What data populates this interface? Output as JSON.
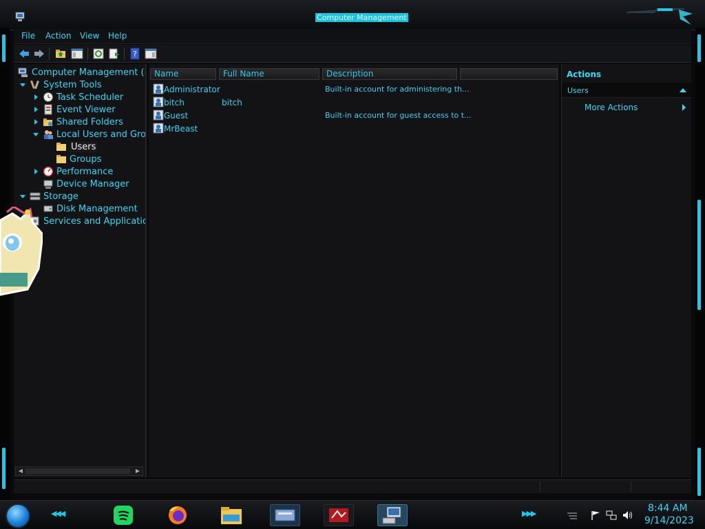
{
  "window": {
    "title": "Computer Management"
  },
  "menu": [
    {
      "label": "File"
    },
    {
      "label": "Action"
    },
    {
      "label": "View"
    },
    {
      "label": "Help"
    }
  ],
  "toolbar": {
    "buttons": [
      {
        "icon": "back-arrow-icon"
      },
      {
        "icon": "forward-arrow-icon"
      },
      {
        "icon": "up-folder-icon"
      },
      {
        "icon": "show-hide-console-tree-icon"
      },
      {
        "icon": "refresh-icon"
      },
      {
        "icon": "export-list-icon"
      },
      {
        "icon": "help-icon"
      },
      {
        "icon": "show-action-pane-icon"
      }
    ]
  },
  "tree": {
    "items": [
      {
        "label": "Computer Management (Loc",
        "icon": "computer-management-icon",
        "level": 0
      },
      {
        "label": "System Tools",
        "icon": "tools-icon",
        "level": 1,
        "expanded": true
      },
      {
        "label": "Task Scheduler",
        "icon": "clock-icon",
        "level": 2
      },
      {
        "label": "Event Viewer",
        "icon": "event-viewer-icon",
        "level": 2
      },
      {
        "label": "Shared Folders",
        "icon": "shared-folder-icon",
        "level": 2
      },
      {
        "label": "Local Users and Grou",
        "icon": "users-icon",
        "level": 2,
        "expanded": true
      },
      {
        "label": "Users",
        "icon": "folder-icon",
        "level": 3,
        "selected": true
      },
      {
        "label": "Groups",
        "icon": "folder-icon",
        "level": 3
      },
      {
        "label": "Performance",
        "icon": "performance-icon",
        "level": 2
      },
      {
        "label": "Device Manager",
        "icon": "device-manager-icon",
        "level": 2
      },
      {
        "label": "Storage",
        "icon": "storage-icon",
        "level": 1,
        "expanded": true
      },
      {
        "label": "Disk Management",
        "icon": "disk-management-icon",
        "level": 2
      },
      {
        "label": "Services and Applications",
        "icon": "services-icon",
        "level": 1
      }
    ]
  },
  "list": {
    "columns": [
      "Name",
      "Full Name",
      "Description",
      ""
    ],
    "rows": [
      {
        "name": "Administrator",
        "full_name": "",
        "description": "Built-in account for administering th..."
      },
      {
        "name": "bitch",
        "full_name": "bitch",
        "description": ""
      },
      {
        "name": "Guest",
        "full_name": "",
        "description": "Built-in account for guest access to t..."
      },
      {
        "name": "MrBeast",
        "full_name": "",
        "description": ""
      }
    ]
  },
  "actions": {
    "title": "Actions",
    "section": "Users",
    "items": [
      {
        "label": "More Actions"
      }
    ]
  },
  "taskbar": {
    "apps": [
      {
        "icon": "spotify-icon"
      },
      {
        "icon": "firefox-icon"
      },
      {
        "icon": "file-explorer-icon"
      },
      {
        "icon": "control-panel-icon"
      },
      {
        "icon": "media-app-icon"
      },
      {
        "icon": "computer-management-icon",
        "active": true
      }
    ],
    "tray": [
      {
        "icon": "flag-icon"
      },
      {
        "icon": "network-icon"
      },
      {
        "icon": "volume-icon"
      }
    ],
    "time": "8:44 AM",
    "date": "9/14/2023"
  },
  "colors": {
    "accent": "#2fd8f5",
    "background": "#131315"
  }
}
